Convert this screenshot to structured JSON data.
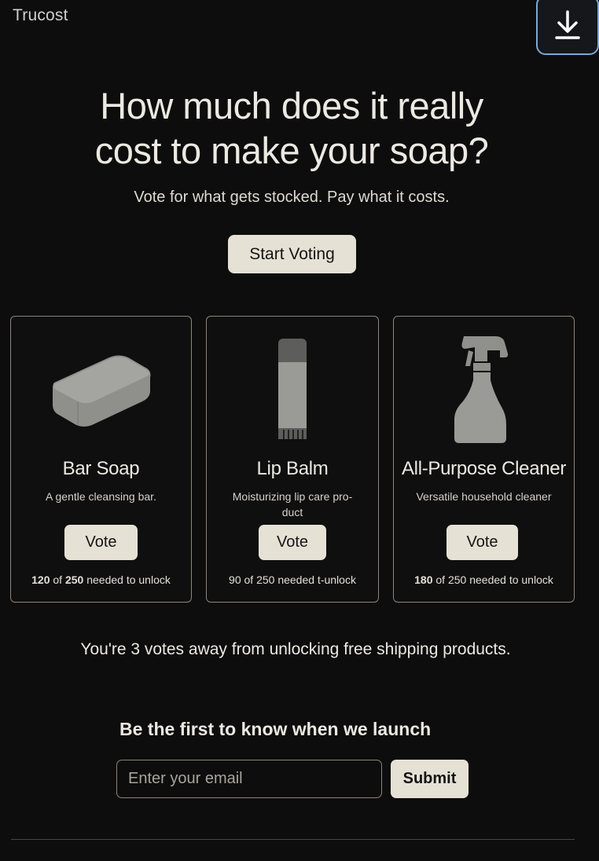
{
  "header": {
    "brand": "Trucost",
    "download_icon": "download-icon"
  },
  "hero": {
    "title_line1": "How much does it really",
    "title_line2": "cost to make your soap?",
    "subtitle": "Vote for what gets stocked. Pay what it costs.",
    "cta_label": "Start Voting"
  },
  "products": [
    {
      "name": "Bar Soap",
      "description": "A gentle cleansing bar.",
      "description_line2": "",
      "vote_label": "Vote",
      "progress_a": "120",
      "progress_mid": " of ",
      "progress_b": "250",
      "progress_tail": " needed to unlock",
      "icon": "soap-bar-icon"
    },
    {
      "name": "Lip Balm",
      "description": "Moisturizing lip care pro-",
      "description_line2": "duct",
      "vote_label": "Vote",
      "progress_a": "90",
      "progress_mid": " of ",
      "progress_b": "250",
      "progress_tail": " needed t-unlock",
      "icon": "lip-balm-icon"
    },
    {
      "name": "All-Purpose Cleaner",
      "description": "Versatile household cleaner",
      "description_line2": "",
      "vote_label": "Vote",
      "progress_a": "180",
      "progress_mid": " of ",
      "progress_b": "250",
      "progress_tail": " needed to unlock",
      "icon": "spray-bottle-icon"
    }
  ],
  "shipping_message": "You're 3 votes away from unlocking free shipping products.",
  "signup": {
    "heading": "Be the first to know when we launch",
    "email_placeholder": "Enter your email",
    "submit_label": "Submit"
  },
  "colors": {
    "background": "#0d0d0d",
    "button": "#e6e1d5",
    "card_border": "#8d8676",
    "accent_border": "#7fa8d6"
  }
}
